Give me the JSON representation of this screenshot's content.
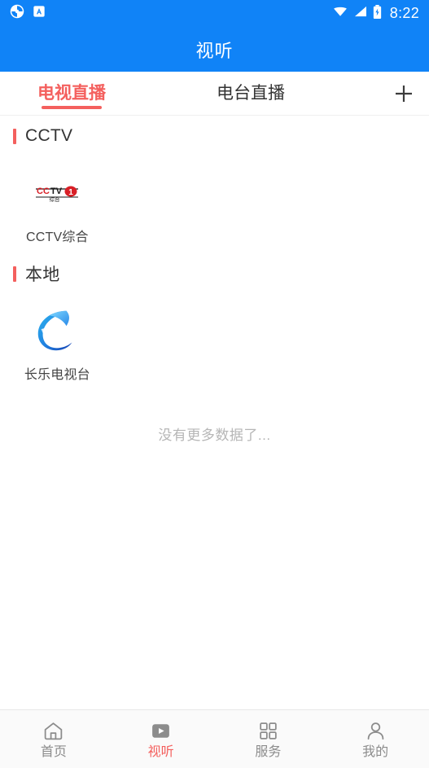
{
  "statusbar": {
    "time": "8:22",
    "icons": [
      "app-notification-icon",
      "a-badge-icon",
      "wifi-icon",
      "signal-icon",
      "battery-charging-icon"
    ]
  },
  "header": {
    "title": "视听"
  },
  "tabs": {
    "items": [
      {
        "label": "电视直播",
        "active": true
      },
      {
        "label": "电台直播",
        "active": false
      }
    ],
    "add_label": "+",
    "active_color": "#f4605e",
    "inactive_color": "#333333"
  },
  "sections": [
    {
      "title": "CCTV",
      "channels": [
        {
          "name": "CCTV综合",
          "logo": "cctv1-logo"
        }
      ]
    },
    {
      "title": "本地",
      "channels": [
        {
          "name": "长乐电视台",
          "logo": "changle-tv-logo"
        }
      ]
    }
  ],
  "footer_hint": "没有更多数据了...",
  "bottomnav": {
    "items": [
      {
        "label": "首页",
        "icon": "home-icon",
        "active": false
      },
      {
        "label": "视听",
        "icon": "play-video-icon",
        "active": true
      },
      {
        "label": "服务",
        "icon": "grid-apps-icon",
        "active": false
      },
      {
        "label": "我的",
        "icon": "person-icon",
        "active": false
      }
    ]
  },
  "colors": {
    "brand_blue": "#1083f7",
    "accent_red": "#f4605e",
    "text_dark": "#333333",
    "text_muted": "#8c8c8c"
  }
}
